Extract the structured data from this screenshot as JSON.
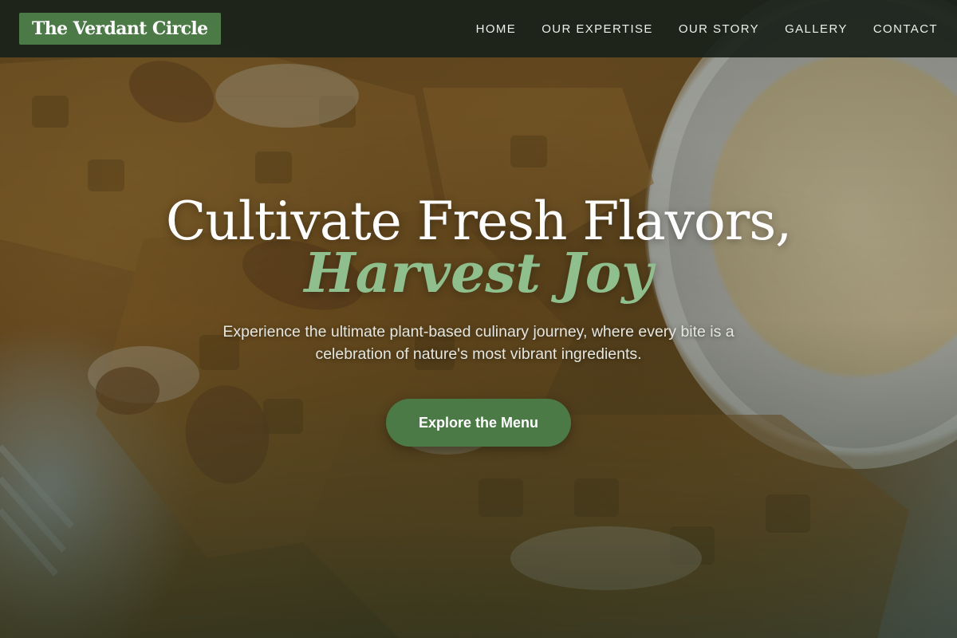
{
  "brand": {
    "name": "The Verdant Circle"
  },
  "nav": {
    "items": [
      {
        "label": "HOME"
      },
      {
        "label": "OUR EXPERTISE"
      },
      {
        "label": "OUR STORY"
      },
      {
        "label": "GALLERY"
      },
      {
        "label": "CONTACT"
      }
    ]
  },
  "hero": {
    "headline_line1": "Cultivate Fresh Flavors,",
    "headline_line2": "Harvest Joy",
    "description": "Experience the ultimate plant-based culinary journey, where every bite is a celebration of nature's most vibrant ingredients.",
    "cta_label": "Explore the Menu",
    "image_icon": "waffles-photo"
  },
  "colors": {
    "brand_green": "#4b7a46",
    "accent_green_text": "#8fbf8d",
    "navbar_bg": "#1a221b",
    "text_light": "#ecefea"
  }
}
